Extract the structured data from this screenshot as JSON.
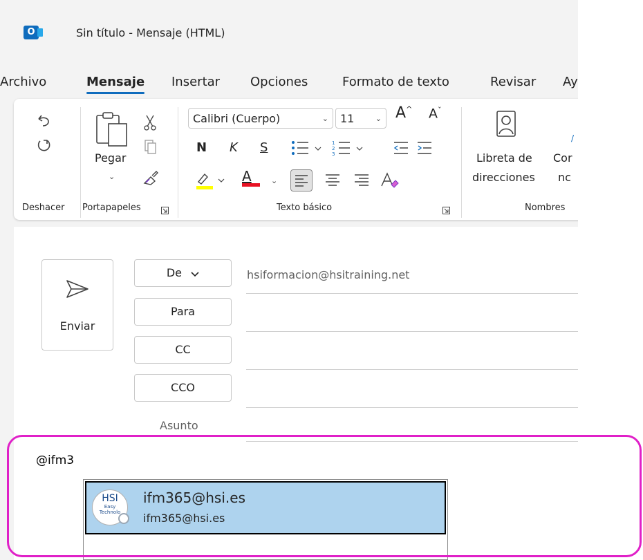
{
  "window": {
    "title": "Sin título  -  Mensaje (HTML)",
    "app_icon_letter": "O"
  },
  "tabs": [
    "Archivo",
    "Mensaje",
    "Insertar",
    "Opciones",
    "Formato de texto",
    "Revisar",
    "Ay"
  ],
  "active_tab": "Mensaje",
  "ribbon": {
    "groups": {
      "undo": "Deshacer",
      "clipboard": "Portapapeles",
      "basic_text": "Texto básico",
      "names": "Nombres"
    },
    "paste_label": "Pegar",
    "font_name": "Calibri (Cuerpo)",
    "font_size": "11",
    "grow_font": "A",
    "shrink_font": "A",
    "bold": "N",
    "italic": "K",
    "underline": "S",
    "font_color_glyph": "A",
    "address_book_line1": "Libreta de",
    "address_book_line2": "direcciones",
    "check_names_line1": "Cor",
    "check_names_line2": "nc"
  },
  "compose": {
    "send_label": "Enviar",
    "from_label": "De",
    "to_label": "Para",
    "cc_label": "CC",
    "bcc_label": "CCO",
    "subject_label": "Asunto",
    "from_address": "hsiformacion@hsitraining.net",
    "body_text": "@ifm3"
  },
  "suggestion": {
    "name": "ifm365@hsi.es",
    "email": "ifm365@hsi.es",
    "avatar_text": "HSI",
    "avatar_subtext_1": "Easy",
    "avatar_subtext_2": "Technolo"
  },
  "colors": {
    "accent": "#0f6cbd",
    "highlight_border": "#e020c8",
    "suggestion_bg": "#aed3ee",
    "highlight_marker": "#ffff00",
    "font_color_bar": "#e81123"
  }
}
